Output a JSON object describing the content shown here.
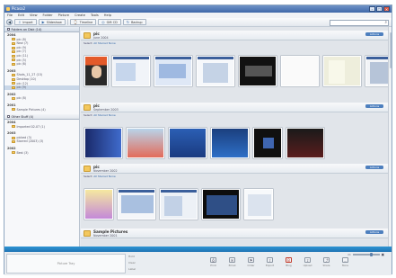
{
  "window": {
    "title": "Picasa2"
  },
  "menu": [
    "File",
    "Edit",
    "View",
    "Folder",
    "Picture",
    "Create",
    "Tools",
    "Help"
  ],
  "toolbar": {
    "buttons": [
      "Import",
      "Slideshow",
      "Timeline",
      "Gift CD",
      "Backup"
    ]
  },
  "left_panel": {
    "folders_head": "Folders on Disk (14)",
    "groups_a": [
      {
        "year": "2004",
        "items": [
          "pic (8)",
          "New (7)",
          "pic (9)",
          "pic (7)",
          "pic (11)",
          "pic (5)",
          "pic (6)"
        ]
      },
      {
        "year": "2003",
        "items": [
          "Shots_11_27 (15)",
          "Desktop (10)",
          "pic (12)",
          "pic (9)"
        ]
      },
      {
        "year": "2002",
        "items": [
          "pic (8)"
        ]
      },
      {
        "year": "2001",
        "items": [
          "Sample Pictures (4)"
        ]
      }
    ],
    "albums_head": "Other Stuff (4)",
    "groups_b": [
      {
        "year": "2004",
        "items": [
          "Imported 02-07 (1)"
        ]
      },
      {
        "year": "2003",
        "items": [
          "picked (3)",
          "Starred (2003) (3)"
        ]
      },
      {
        "year": "2002",
        "items": [
          "Best (3)"
        ]
      }
    ]
  },
  "main": {
    "groups": [
      {
        "name": "pic",
        "date": "June 2004",
        "badge": "Actions",
        "select_label": "Select:",
        "select_links": "All  Starred  None",
        "thumbs": 8
      },
      {
        "name": "pic",
        "date": "September 2003",
        "badge": "Actions",
        "select_label": "Select:",
        "select_links": "All  Starred  None",
        "thumbs": 6
      },
      {
        "name": "pic",
        "date": "November 2002",
        "badge": "Actions",
        "select_label": "Select:",
        "select_links": "All  Starred  None",
        "thumbs": 5
      },
      {
        "name": "Sample Pictures",
        "date": "November 2001",
        "badge": "Actions"
      }
    ]
  },
  "bottom": {
    "tray_text": "Picture Tray",
    "side_labels": [
      "Hold",
      "Clear",
      "Label"
    ],
    "actions": [
      "Print",
      "Email",
      "Order",
      "Export",
      "Blog",
      "Upload",
      "Share",
      "More"
    ]
  },
  "colors": {
    "accent": "#1f74b4",
    "title_bar": "#3f68a8",
    "folder": "#f3c85e",
    "badge": "#4d7fbe"
  }
}
